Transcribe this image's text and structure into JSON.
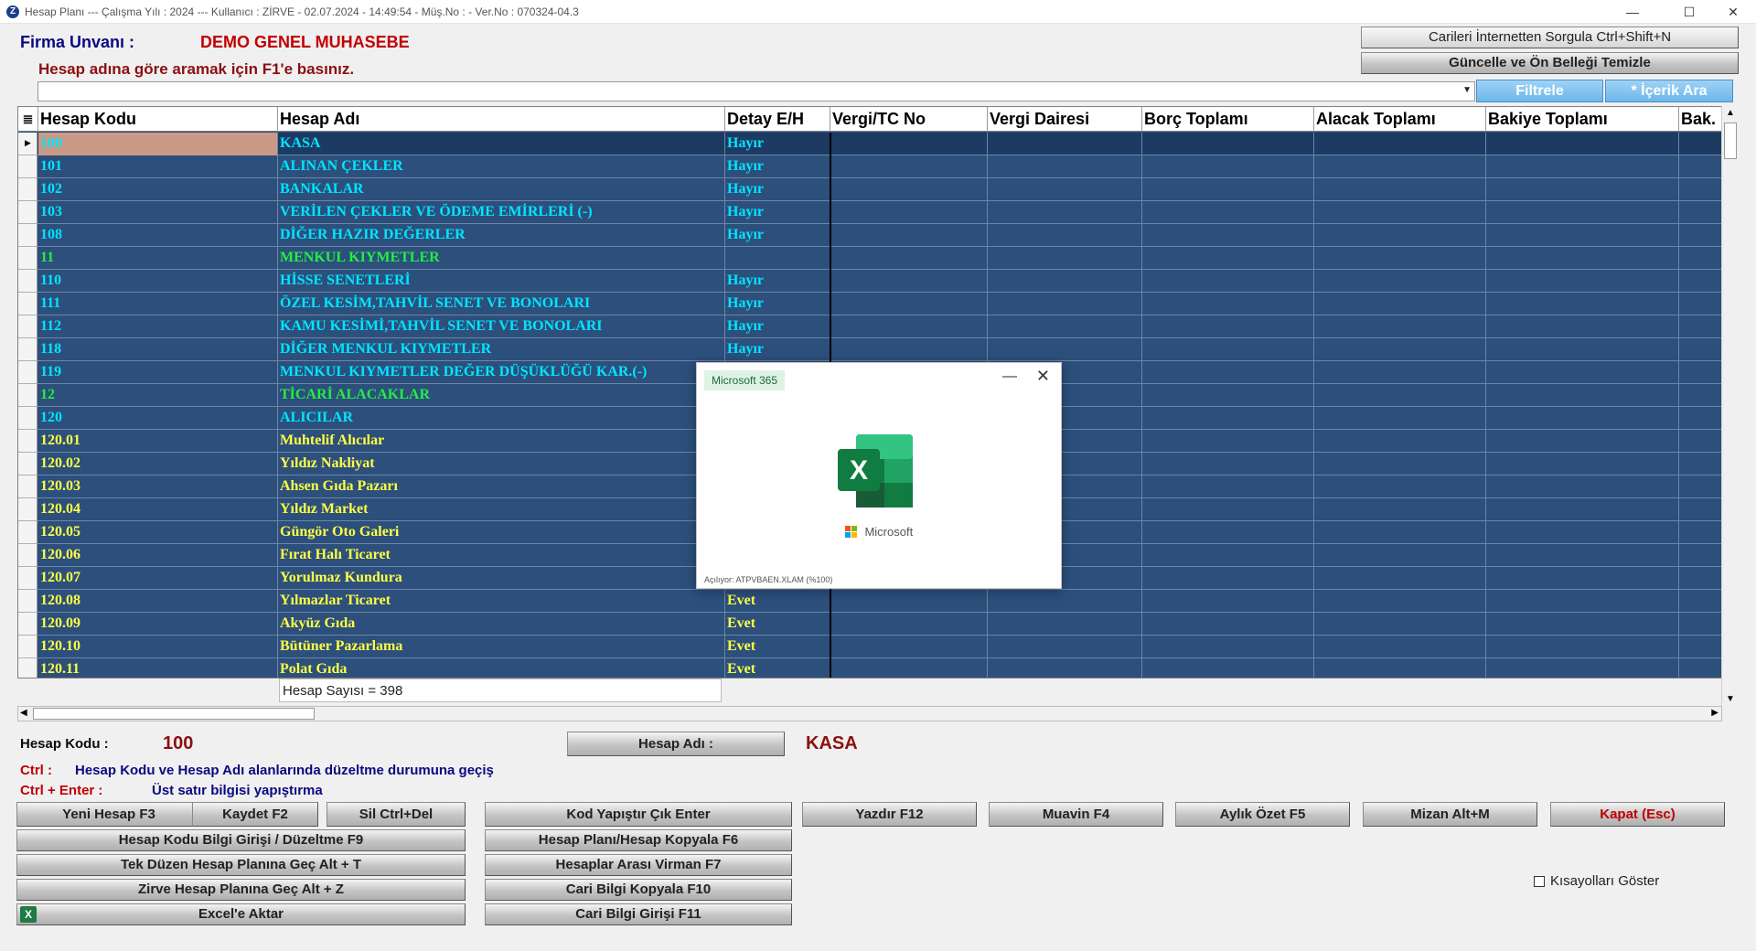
{
  "titlebar": {
    "text": "Hesap Planı  ---  Çalışma Yılı : 2024  ---  Kullanıcı : ZİRVE  - 02.07.2024 - 14:49:54 - Müş.No :  - Ver.No : 070324-04.3",
    "minimize": "—",
    "maximize": "☐",
    "close": "✕"
  },
  "header": {
    "firma_label": "Firma Unvanı :",
    "firma_name": "DEMO GENEL MUHASEBE",
    "search_hint": "Hesap adına göre aramak için F1'e basınız.",
    "btn_carileri": "Carileri İnternetten Sorgula Ctrl+Shift+N",
    "btn_guncelle": "Güncelle ve Ön Belleği Temizle",
    "btn_filtrele": "Filtrele",
    "btn_icerik": "* İçerik Ara",
    "search_value": ""
  },
  "grid": {
    "columns": [
      "Hesap Kodu",
      "Hesap Adı",
      "Detay E/H",
      "Vergi/TC No",
      "Vergi Dairesi",
      "Borç Toplamı",
      "Alacak Toplamı",
      "Bakiye Toplamı",
      "Bak."
    ],
    "rows": [
      {
        "kod": "100",
        "adi": "KASA",
        "detay": "Hayır",
        "color": "cyan"
      },
      {
        "kod": "101",
        "adi": "ALINAN ÇEKLER",
        "detay": "Hayır",
        "color": "cyan"
      },
      {
        "kod": "102",
        "adi": "BANKALAR",
        "detay": "Hayır",
        "color": "cyan"
      },
      {
        "kod": "103",
        "adi": "VERİLEN ÇEKLER VE ÖDEME EMİRLERİ (-)",
        "detay": "Hayır",
        "color": "cyan"
      },
      {
        "kod": "108",
        "adi": "DİĞER HAZIR DEĞERLER",
        "detay": "Hayır",
        "color": "cyan"
      },
      {
        "kod": "11",
        "adi": "MENKUL KIYMETLER",
        "detay": "",
        "color": "green"
      },
      {
        "kod": "110",
        "adi": "HİSSE SENETLERİ",
        "detay": "Hayır",
        "color": "cyan"
      },
      {
        "kod": "111",
        "adi": "ÖZEL KESİM,TAHVİL SENET VE BONOLARI",
        "detay": "Hayır",
        "color": "cyan"
      },
      {
        "kod": "112",
        "adi": "KAMU KESİMİ,TAHVİL SENET VE BONOLARI",
        "detay": "Hayır",
        "color": "cyan"
      },
      {
        "kod": "118",
        "adi": "DİĞER MENKUL KIYMETLER",
        "detay": "Hayır",
        "color": "cyan"
      },
      {
        "kod": "119",
        "adi": "MENKUL KIYMETLER DEĞER DÜŞÜKLÜĞÜ KAR.(-)",
        "detay": "",
        "color": "cyan"
      },
      {
        "kod": "12",
        "adi": "TİCARİ ALACAKLAR",
        "detay": "",
        "color": "green"
      },
      {
        "kod": "120",
        "adi": "ALICILAR",
        "detay": "",
        "color": "cyan"
      },
      {
        "kod": "120.01",
        "adi": "Muhtelif Alıcılar",
        "detay": "",
        "color": "yellow"
      },
      {
        "kod": "120.02",
        "adi": "Yıldız Nakliyat",
        "detay": "",
        "color": "yellow"
      },
      {
        "kod": "120.03",
        "adi": "Ahsen Gıda Pazarı",
        "detay": "",
        "color": "yellow"
      },
      {
        "kod": "120.04",
        "adi": "Yıldız Market",
        "detay": "",
        "color": "yellow"
      },
      {
        "kod": "120.05",
        "adi": "Güngör Oto Galeri",
        "detay": "",
        "color": "yellow"
      },
      {
        "kod": "120.06",
        "adi": "Fırat Halı Ticaret",
        "detay": "",
        "color": "yellow"
      },
      {
        "kod": "120.07",
        "adi": "Yorulmaz Kundura",
        "detay": "",
        "color": "yellow"
      },
      {
        "kod": "120.08",
        "adi": "Yılmazlar Ticaret",
        "detay": "Evet",
        "color": "yellow"
      },
      {
        "kod": "120.09",
        "adi": "Akyüz Gıda",
        "detay": "Evet",
        "color": "yellow"
      },
      {
        "kod": "120.10",
        "adi": "Bütüner Pazarlama",
        "detay": "Evet",
        "color": "yellow"
      },
      {
        "kod": "120.11",
        "adi": "Polat Gıda",
        "detay": "Evet",
        "color": "yellow"
      }
    ],
    "count_text": "Hesap Sayısı = 398"
  },
  "dialog": {
    "badge": "Microsoft 365",
    "minimize": "—",
    "close": "✕",
    "excel_letter": "X",
    "ms_text": "Microsoft",
    "status": "Açılıyor: ATPVBAEN.XLAM  (%100)"
  },
  "bottom": {
    "hesap_kodu_label": "Hesap Kodu :",
    "hesap_kodu_value": "100",
    "hesap_adi_btn": "Hesap Adı :",
    "hesap_adi_value": "KASA",
    "ctrl_label": "Ctrl :",
    "ctrl_desc": "Hesap Kodu ve Hesap Adı alanlarında düzeltme durumuna geçiş",
    "ctrl_enter_label": "Ctrl + Enter :",
    "ctrl_enter_desc": "Üst satır bilgisi yapıştırma",
    "btn_yeni": "Yeni Hesap F3",
    "btn_kaydet": "Kaydet F2",
    "btn_sil": "Sil Ctrl+Del",
    "btn_kod_yapistir": "Kod Yapıştır Çık Enter",
    "btn_yazdir": "Yazdır F12",
    "btn_muavin": "Muavin F4",
    "btn_aylik": "Aylık Özet F5",
    "btn_mizan": "Mizan Alt+M",
    "btn_kapat": "Kapat (Esc)",
    "btn_bilgi_girisi": "Hesap Kodu Bilgi Girişi / Düzeltme F9",
    "btn_kopyala": "Hesap Planı/Hesap Kopyala F6",
    "btn_tek_duzen": "Tek Düzen Hesap Planına Geç Alt + T",
    "btn_virman": "Hesaplar Arası Virman F7",
    "btn_zirve": "Zirve Hesap Planına Geç Alt + Z",
    "btn_cari_kopyala": "Cari Bilgi Kopyala F10",
    "btn_excel": "Excel'e Aktar",
    "btn_cari_giris": "Cari Bilgi Girişi F11",
    "chk_kisayollar": "Kısayolları Göster"
  }
}
